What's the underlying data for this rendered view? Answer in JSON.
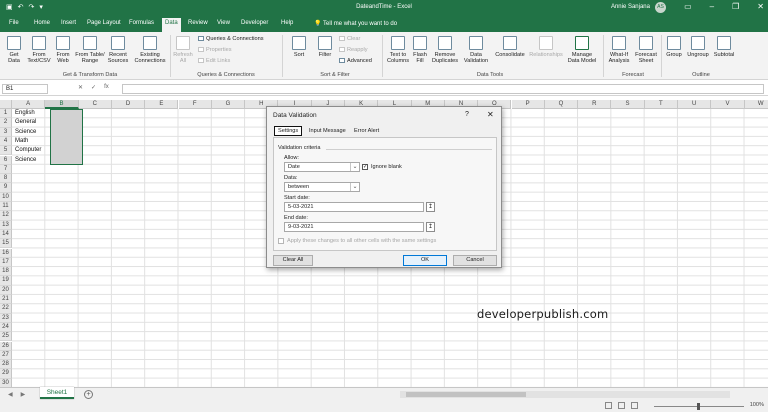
{
  "titlebar": {
    "title": "DateandTime  -  Excel",
    "user": "Annie Sanjana",
    "avatar_initials": "AS",
    "qat_icons": [
      "save-icon",
      "undo-icon",
      "redo-icon",
      "customize-icon"
    ],
    "window_controls": [
      "ribbon-display-icon",
      "minimize-icon",
      "restore-icon",
      "close-icon"
    ]
  },
  "tabs": [
    "File",
    "Home",
    "Insert",
    "Page Layout",
    "Formulas",
    "Data",
    "Review",
    "View",
    "Developer",
    "Help"
  ],
  "active_tab": "Data",
  "tell_me": "Tell me what you want to do",
  "ribbon": {
    "get_data": "Get Data",
    "from_text_csv": "From Text/CSV",
    "from_web": "From Web",
    "from_table_range": "From Table/ Range",
    "recent_sources": "Recent Sources",
    "existing_connections": "Existing Connections",
    "refresh_all": "Refresh All",
    "queries_connections": "Queries & Connections",
    "properties": "Properties",
    "edit_links": "Edit Links",
    "sort": "Sort",
    "filter": "Filter",
    "clear": "Clear",
    "reapply": "Reapply",
    "advanced": "Advanced",
    "text_to_columns": "Text to Columns",
    "flash_fill": "Flash Fill",
    "remove_duplicates": "Remove Duplicates",
    "data_validation": "Data Validation",
    "consolidate": "Consolidate",
    "relationships": "Relationships",
    "manage_data_model": "Manage Data Model",
    "what_if": "What-If Analysis",
    "forecast_sheet": "Forecast Sheet",
    "group": "Group",
    "ungroup": "Ungroup",
    "subtotal": "Subtotal",
    "groups": {
      "get_transform": "Get & Transform Data",
      "queries": "Queries & Connections",
      "sort_filter": "Sort & Filter",
      "data_tools": "Data Tools",
      "forecast": "Forecast",
      "outline": "Outline"
    }
  },
  "formula_bar": {
    "name_box": "B1",
    "cancel": "✕",
    "enter": "✓",
    "fx": "fx",
    "value": ""
  },
  "columns": [
    "A",
    "B",
    "C",
    "D",
    "E",
    "F",
    "G",
    "H",
    "I",
    "J",
    "K",
    "L",
    "M",
    "N",
    "O",
    "P",
    "Q",
    "R",
    "S",
    "T",
    "U",
    "V",
    "W"
  ],
  "selected_column": "B",
  "rows": [
    "1",
    "2",
    "3",
    "4",
    "5",
    "6",
    "7",
    "8",
    "9",
    "10",
    "11",
    "12",
    "13",
    "14",
    "15",
    "16",
    "17",
    "18",
    "19",
    "20",
    "21",
    "22",
    "23",
    "24",
    "25",
    "26",
    "27",
    "28",
    "29",
    "30"
  ],
  "cells": {
    "A1": "English",
    "A2": "General",
    "A3": "Science",
    "A4": "Math",
    "A5": "Computer",
    "A6": "Science"
  },
  "sheet_tab": "Sheet1",
  "zoom": "100%",
  "dialog": {
    "title": "Data Validation",
    "help": "?",
    "close": "✕",
    "tabs": [
      "Settings",
      "Input Message",
      "Error Alert"
    ],
    "validation_criteria": "Validation criteria",
    "allow_label": "Allow:",
    "allow_value": "Date",
    "ignore_blank": "Ignore blank",
    "data_label": "Data:",
    "data_value": "between",
    "start_label": "Start date:",
    "start_value": "5-03-2021",
    "end_label": "End date:",
    "end_value": "9-03-2021",
    "apply_all": "Apply these changes to all other cells with the same settings",
    "clear_all": "Clear All",
    "ok": "OK",
    "cancel": "Cancel"
  },
  "watermark": "developerpublish.com"
}
